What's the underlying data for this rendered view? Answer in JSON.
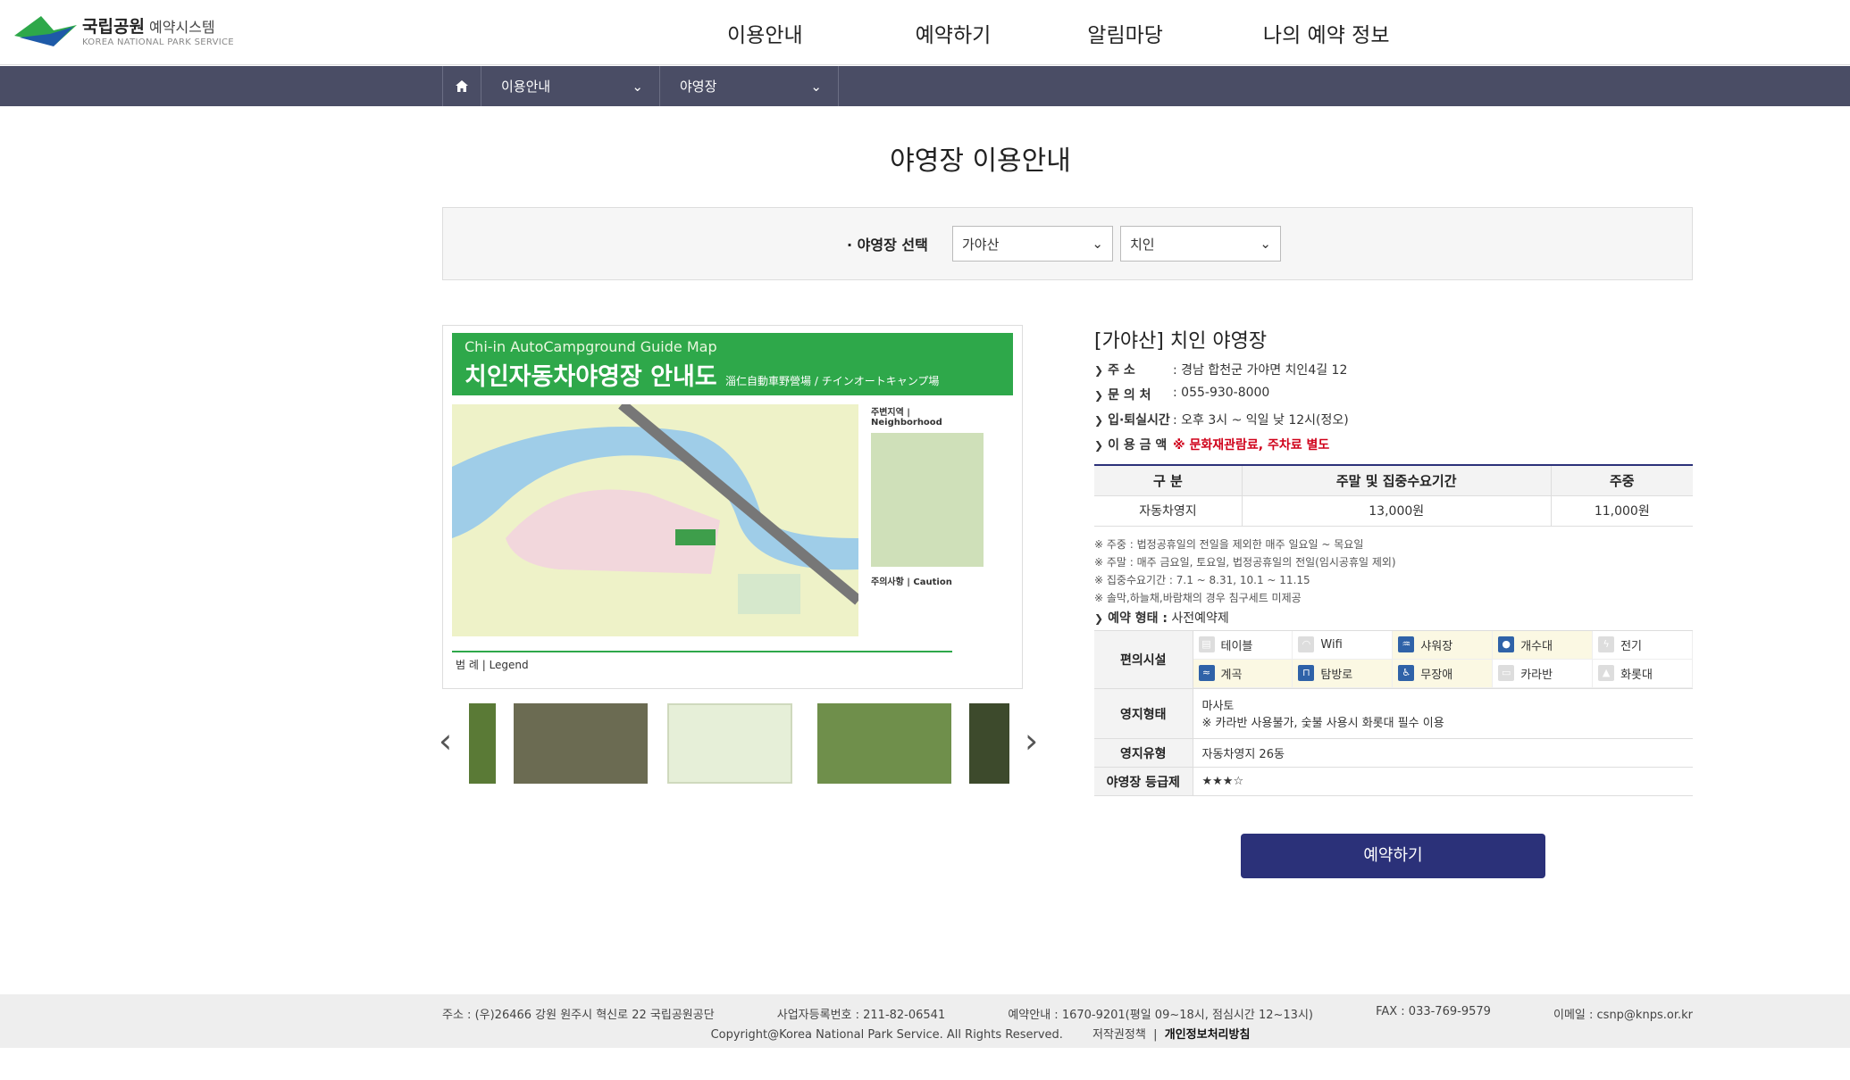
{
  "header": {
    "logo_main": "국립공원",
    "logo_sub": "예약시스템",
    "logo_en": "KOREA NATIONAL PARK SERVICE",
    "nav": [
      "이용안내",
      "예약하기",
      "알림마당",
      "나의 예약 정보"
    ]
  },
  "subnav": {
    "crumb1": "이용안내",
    "crumb2": "야영장"
  },
  "page_title": "야영장 이용안내",
  "selector": {
    "label": "· 야영장 선택",
    "park": "가야산",
    "site": "치인"
  },
  "map": {
    "title_en": "Chi-in AutoCampground Guide Map",
    "title_kr": "치인자동차야영장 안내도",
    "title_cjk": "淄仁自動車野營場 / チインオートキャンプ場",
    "legend": "범 례 | Legend",
    "side1": "주변지역 | Neighborhood",
    "side2": "주의사항 | Caution"
  },
  "info": {
    "title": "[가야산] 치인 야영장",
    "rows": [
      {
        "k": "주        소",
        "v": ": 경남 합천군 가야면 치인4길 12"
      },
      {
        "k": "문   의   처",
        "v": ": 055-930-8000"
      },
      {
        "k": "입·퇴실시간",
        "v": ": 오후 3시 ~ 익일 낮 12시(정오)"
      },
      {
        "k": "이 용 금 액",
        "v": "※ 문화재관람료, 주차료 별도"
      }
    ],
    "price_head": [
      "구 분",
      "주말 및 집중수요기간",
      "주중"
    ],
    "price_row": [
      "자동차영지",
      "13,000원",
      "11,000원"
    ],
    "notes": [
      "※ 주중 : 법정공휴일의 전일을 제외한 매주 일요일 ~ 목요일",
      "※ 주말 : 매주 금요일, 토요일, 법정공휴일의 전일(임시공휴일 제외)",
      "※ 집중수요기간 : 7.1 ~ 8.31, 10.1 ~ 11.15",
      "※ 솔막,하늘채,바람채의 경우 침구세트 미제공"
    ],
    "form_label": "예약 형태 :",
    "form_value": "사전예약제",
    "facility_label": "편의시설",
    "facilities": [
      {
        "name": "테이블",
        "on": false
      },
      {
        "name": "Wifi",
        "on": false
      },
      {
        "name": "샤워장",
        "on": true
      },
      {
        "name": "개수대",
        "on": true
      },
      {
        "name": "전기",
        "on": false
      },
      {
        "name": "계곡",
        "on": true
      },
      {
        "name": "탐방로",
        "on": true
      },
      {
        "name": "무장애",
        "on": true
      },
      {
        "name": "카라반",
        "on": false
      },
      {
        "name": "화롯대",
        "on": false
      }
    ],
    "type_label": "영지형태",
    "type_value1": "마사토",
    "type_value2": "※ 카라반 사용불가, 숯불 사용시 화롯대 필수 이용",
    "kind_label": "영지유형",
    "kind_value": "자동차영지 26동",
    "grade_label": "야영장 등급제",
    "grade_value": "★★★☆"
  },
  "reserve_button": "예약하기",
  "footer": {
    "address": "주소 : (우)26466 강원 원주시 혁신로 22 국립공원공단",
    "bizno": "사업자등록번호 : 211-82-06541",
    "phone": "예약안내 : 1670-9201(평일 09~18시, 점심시간 12~13시)",
    "fax": "FAX : 033-769-9579",
    "email": "이메일 : csnp@knps.or.kr",
    "copyright": "Copyright@Korea National Park Service. All Rights Reserved.",
    "copyright_policy": "저작권정책",
    "privacy": "개인정보처리방침"
  }
}
